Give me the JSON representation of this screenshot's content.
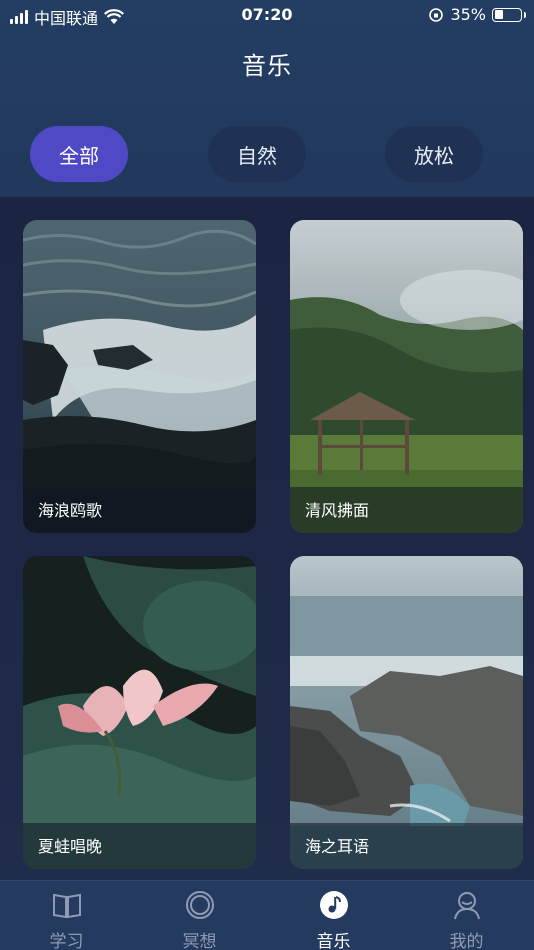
{
  "status_bar": {
    "carrier": "中国联通",
    "time": "07:20",
    "battery": "35%",
    "battery_level": 0.35
  },
  "header": {
    "title": "音乐"
  },
  "filters": [
    {
      "label": "全部",
      "active": true
    },
    {
      "label": "自然",
      "active": false
    },
    {
      "label": "放松",
      "active": false
    }
  ],
  "cards": [
    {
      "title": "海浪鸥歌"
    },
    {
      "title": "清风拂面"
    },
    {
      "title": "夏蛙唱晚"
    },
    {
      "title": "海之耳语"
    }
  ],
  "tabs": [
    {
      "label": "学习",
      "icon": "book-icon",
      "active": false
    },
    {
      "label": "冥想",
      "icon": "circle-icon",
      "active": false
    },
    {
      "label": "音乐",
      "icon": "music-disc-icon",
      "active": true
    },
    {
      "label": "我的",
      "icon": "person-icon",
      "active": false
    }
  ],
  "colors": {
    "accent": "#5049c5",
    "header_bg": "#233e63",
    "content_bg": "#1b2440",
    "tab_inactive": "#8f9bb3"
  }
}
